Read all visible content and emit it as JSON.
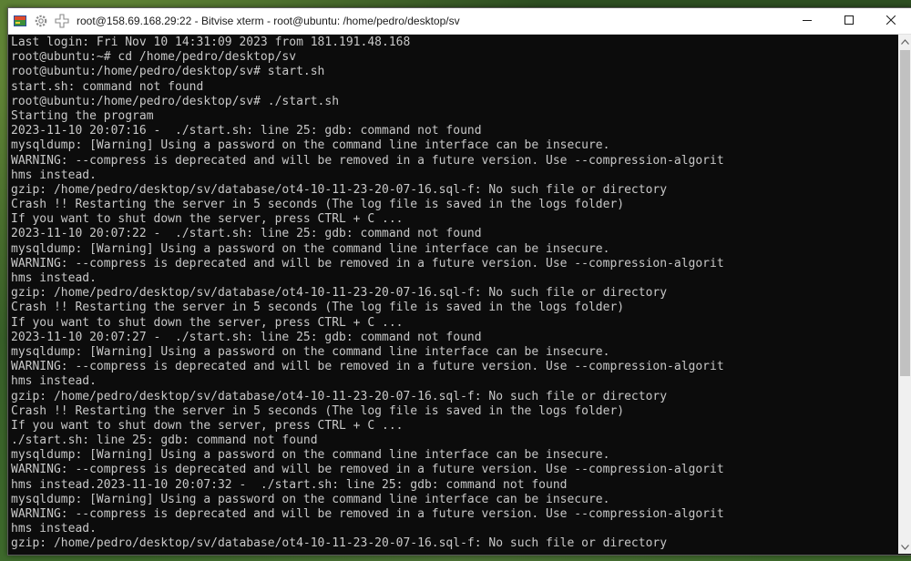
{
  "window": {
    "title": "root@158.69.168.29:22 - Bitvise xterm - root@ubuntu: /home/pedro/desktop/sv"
  },
  "colors": {
    "terminal_bg": "#0c0c0c",
    "terminal_fg": "#c8c8c8",
    "titlebar_bg": "#ffffff"
  },
  "icons": {
    "app": "bitvise-xterm-icon",
    "settings": "gear-icon",
    "new": "plus-icon",
    "minimize": "minimize-icon",
    "maximize": "maximize-icon",
    "close": "close-icon"
  },
  "terminal": {
    "lines": [
      "Last login: Fri Nov 10 14:31:09 2023 from 181.191.48.168",
      "root@ubuntu:~# cd /home/pedro/desktop/sv",
      "root@ubuntu:/home/pedro/desktop/sv# start.sh",
      "start.sh: command not found",
      "root@ubuntu:/home/pedro/desktop/sv# ./start.sh",
      "Starting the program",
      "2023-11-10 20:07:16 -  ./start.sh: line 25: gdb: command not found",
      "mysqldump: [Warning] Using a password on the command line interface can be insecure.",
      "WARNING: --compress is deprecated and will be removed in a future version. Use --compression-algorit",
      "hms instead.",
      "gzip: /home/pedro/desktop/sv/database/ot4-10-11-23-20-07-16.sql-f: No such file or directory",
      "Crash !! Restarting the server in 5 seconds (The log file is saved in the logs folder)",
      "If you want to shut down the server, press CTRL + C ...",
      "2023-11-10 20:07:22 -  ./start.sh: line 25: gdb: command not found",
      "mysqldump: [Warning] Using a password on the command line interface can be insecure.",
      "WARNING: --compress is deprecated and will be removed in a future version. Use --compression-algorit",
      "hms instead.",
      "gzip: /home/pedro/desktop/sv/database/ot4-10-11-23-20-07-16.sql-f: No such file or directory",
      "Crash !! Restarting the server in 5 seconds (The log file is saved in the logs folder)",
      "If you want to shut down the server, press CTRL + C ...",
      "2023-11-10 20:07:27 -  ./start.sh: line 25: gdb: command not found",
      "mysqldump: [Warning] Using a password on the command line interface can be insecure.",
      "WARNING: --compress is deprecated and will be removed in a future version. Use --compression-algorit",
      "hms instead.",
      "gzip: /home/pedro/desktop/sv/database/ot4-10-11-23-20-07-16.sql-f: No such file or directory",
      "Crash !! Restarting the server in 5 seconds (The log file is saved in the logs folder)",
      "If you want to shut down the server, press CTRL + C ...",
      "./start.sh: line 25: gdb: command not found",
      "mysqldump: [Warning] Using a password on the command line interface can be insecure.",
      "WARNING: --compress is deprecated and will be removed in a future version. Use --compression-algorit",
      "hms instead.2023-11-10 20:07:32 -  ./start.sh: line 25: gdb: command not found",
      "mysqldump: [Warning] Using a password on the command line interface can be insecure.",
      "WARNING: --compress is deprecated and will be removed in a future version. Use --compression-algorit",
      "hms instead.",
      "gzip: /home/pedro/desktop/sv/database/ot4-10-11-23-20-07-16.sql-f: No such file or directory"
    ]
  }
}
